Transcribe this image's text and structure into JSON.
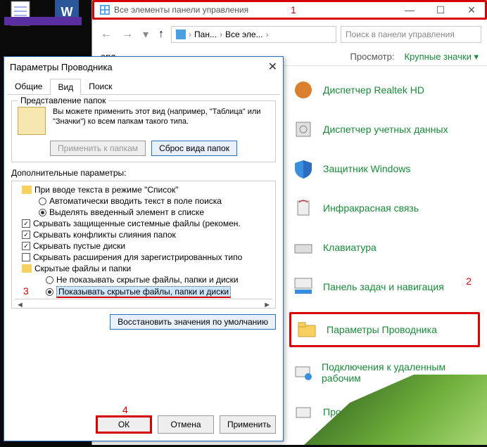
{
  "window": {
    "title": "Все элементы панели управления",
    "search_placeholder": "Поиск в панели управления",
    "crumbs": [
      "Пан...",
      "Все эле..."
    ],
    "toolbar": {
      "home_label": "ера",
      "view_label": "Просмотр:",
      "view_mode": "Крупные значки"
    }
  },
  "cp_items": [
    {
      "name": "realtek",
      "label": "Диспетчер Realtek HD"
    },
    {
      "name": "credentials",
      "label": "Диспетчер учетных данных"
    },
    {
      "name": "defender",
      "label": "Защитник Windows"
    },
    {
      "name": "infrared",
      "label": "Инфракрасная связь"
    },
    {
      "name": "keyboard",
      "label": "Клавиатура"
    },
    {
      "name": "taskbar",
      "label": "Панель задач и навигация"
    },
    {
      "name": "explorer-options",
      "label": "Параметры Проводника"
    },
    {
      "name": "remote",
      "label": "Подключения к удаленным рабочим"
    },
    {
      "name": "programs",
      "label": "Программы по"
    }
  ],
  "dialog": {
    "title": "Параметры Проводника",
    "tabs": {
      "general": "Общие",
      "view": "Вид",
      "search": "Поиск"
    },
    "group": {
      "title": "Представление папок",
      "desc": "Вы можете применить этот вид (например, \"Таблица\" или \"Значки\") ко всем папкам такого типа.",
      "apply": "Применить к папкам",
      "reset": "Сброс вида папок"
    },
    "params_label": "Дополнительные параметры:",
    "tree": {
      "root": "При вводе текста в режиме \"Список\"",
      "r1": "Автоматически вводить текст в поле поиска",
      "r2": "Выделять введенный элемент в списке",
      "c1": "Скрывать защищенные системные файлы (рекомен.",
      "c2": "Скрывать конфликты слияния папок",
      "c3": "Скрывать пустые диски",
      "c4": "Скрывать расширения для зарегистрированных типо",
      "folder": "Скрытые файлы и папки",
      "f1": "Не показывать скрытые файлы, папки и диски",
      "f2": "Показывать скрытые файлы, папки и диски"
    },
    "restore": "Восстановить значения по умолчанию",
    "buttons": {
      "ok": "ОК",
      "cancel": "Отмена",
      "apply": "Применить"
    }
  },
  "annotations": {
    "a1": "1",
    "a2": "2",
    "a3": "3",
    "a4": "4"
  }
}
